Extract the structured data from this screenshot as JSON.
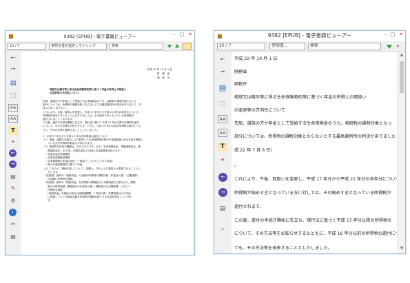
{
  "window_small": {
    "title": "9382 [EPUB] - 電子書籍ビューアー",
    "toolbar": {
      "page_indicator": "13 / 7",
      "toc_placeholder": "参照全書を指定してジャンプ",
      "search_placeholder": "検索"
    },
    "document": {
      "date": "平成 22 年 10 月 1 日",
      "from1": "財　務　省",
      "from2": "国　税　庁",
      "heading1": "相続又は贈与等に係る生命保険契約等に基づく年金の所得上の取扱い",
      "heading2": "の変更等の方向性について",
      "body": [
        "先般、遺族の方が年金として受給する生命保険金のうち、相続税の課税対象となった",
        "部分については、所得税の課税対象とならないとする最高裁判所の判決がありました（平",
        "成 22 年 7 月 6 日）。",
        "これにより、今後、取扱いを変更し、平成 17 年分から平成 21 年分の各年分について",
        "所得税が納めすぎとなっている方に対しては、その納めすぎとなっている所得税が",
        "還付されることとなります。",
        "この度、還付の手続き開始に先立ち、現行法に基づく平成 17 年分以降の所得税の還付",
        "について、その方法等をお知らせするとともに、平成 16 年分以前の所得税の還付につい",
        "ても、その方法等を発表することとしたしました。",
        "",
        "1．平成 17 年分から平成 21 年分の所得税の還付について",
        "（1）相続、遺贈又は贈与により取得した生命保険契約等の年金受給権に係る年金を受給し",
        "　　ている方が所得税の取扱いが変わります。",
        "（2）具体的な年金の種類は、次のとおりです。なお、生命保険会社、損害保険会社、郵",
        "　　便保険会社、JA 共済、全国共済などの個人年金保険等は除きます。",
        "　・年金払型生命保険等",
        "　・年金払型損害保険等",
        "　・生命保険等の年金払特約（一時金としてもたらされた年金）",
        "　・個人年金保険契約に基づく年金",
        "（3）これらの「相続年金」について、税務上、次のように取扱いが変更されることとい",
        "　　たします。",
        "　（変更前）各年の「相続年金」の全額が所得税の課税対象（年金収入額 − 必要経費）",
        "　　の金額に所得税を課税。",
        "　（変更後）各年の「相続年金」を所得税の課税部分と非課税部分に振り分け、課税",
        "　　部分の所得金額（課税部分の年金収入額 − 課税部分の必要経費）に対して",
        "　　所得税を課税。",
        "　　「相続年金」を相続の時点以後受領期間、2 年目以降、非課税部分から年金",
        "　　に経過していく利息相当額を所得税の課税対象とする年金を算定していきま",
        "　　す。"
      ]
    }
  },
  "window_large": {
    "title": "9382 [EPUB] - 電子書籍ビューアー",
    "toolbar": {
      "page_indicator": "20 / 7",
      "toc_placeholder": "参照書...",
      "search_placeholder": "検索"
    },
    "document": {
      "lines": [
        "平成 22 年 10 月 1 日",
        "財務省",
        "国税庁",
        "相続又は贈与等に係る生命保険契約等に基づく年金の所得上の取扱い",
        "の変更等の方向性について",
        "先般、遺族の方が年金として受給する生命保険金のうち、相続税の課税対象となっ",
        "部分については、所得税の課税対象とならないとする最高裁判所の判決がありました（平",
        "成 22 年 7 月 6 日）",
        "。",
        "これにより、今後、取扱いを変更し、平成 17 年分から平成 21 年分の各年分について",
        "所得税が納めすぎとなっている方に対しては、その納めすぎとなっている所得税が",
        "還付されます。",
        "この度、還付の手続き開始に先立ち、現行法に基づく平成 17 年分以降の所得税の",
        "について、その方法等をお知らせするとともに、平成 16 年分以前の所得税の還付につい",
        "ても、その方法等を発表することとしたしました。"
      ]
    }
  },
  "colors": {
    "accent_green": "#2e9e3a",
    "icon_purple": "#5a4aa8",
    "info_blue": "#2c6fc9",
    "close_red": "#c42b1c",
    "frame_border": "#9dbcd8"
  },
  "icons": {
    "sidebar": [
      "back-arrow-icon",
      "forward-arrow-icon",
      "bookmark-icon",
      "page-icon",
      "font-larger-icon",
      "font-smaller-icon",
      "text-style-icon",
      "fit-page-icon",
      "prev-page-icon",
      "next-page-icon",
      "library-icon",
      "settings-icon",
      "info-icon",
      "scissors-icon",
      "print-icon"
    ]
  }
}
